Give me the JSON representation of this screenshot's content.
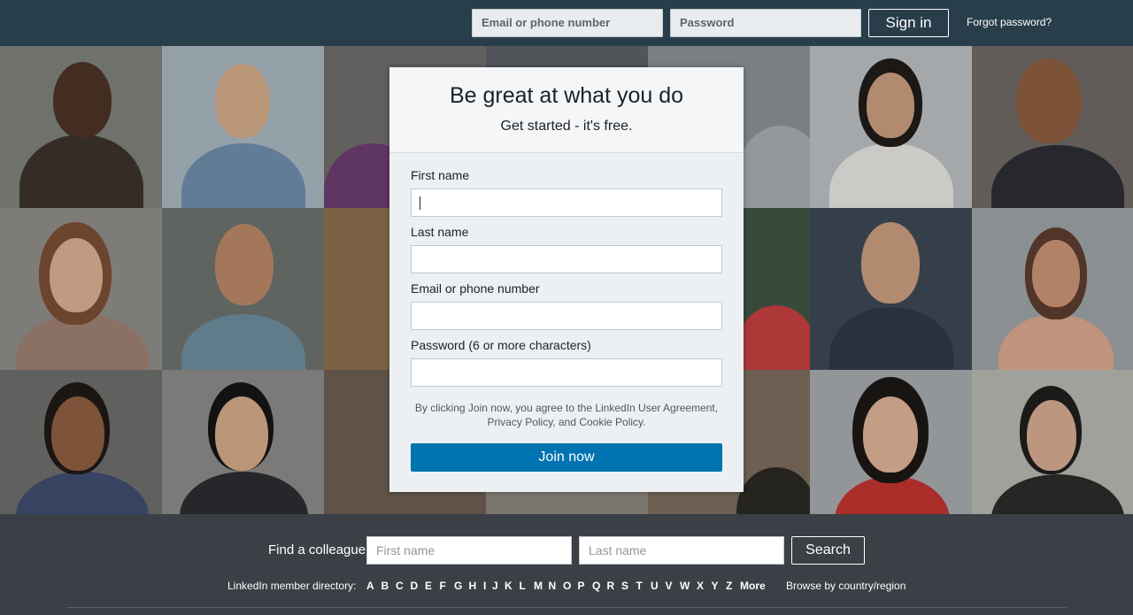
{
  "topbar": {
    "email_placeholder": "Email or phone number",
    "password_placeholder": "Password",
    "signin_label": "Sign in",
    "forgot_label": "Forgot password?"
  },
  "signup": {
    "title": "Be great at what you do",
    "subtitle": "Get started - it's free.",
    "fields": {
      "first_name": "First name",
      "last_name": "Last name",
      "email": "Email or phone number",
      "password": "Password (6 or more characters)"
    },
    "legal_line1": "By clicking Join now, you agree to the LinkedIn User Agreement,",
    "legal_line2": "Privacy Policy, and Cookie Policy.",
    "join_label": "Join now"
  },
  "find": {
    "label": "Find a colleague",
    "first_placeholder": "First name",
    "last_placeholder": "Last name",
    "search_label": "Search"
  },
  "directory": {
    "label": "LinkedIn member directory:",
    "letters": [
      "A",
      "B",
      "C",
      "D",
      "E",
      "F",
      "G",
      "H",
      "I",
      "J",
      "K",
      "L",
      "M",
      "N",
      "O",
      "P",
      "Q",
      "R",
      "S",
      "T",
      "U",
      "V",
      "W",
      "X",
      "Y",
      "Z"
    ],
    "more_label": "More",
    "country_label": "Browse by country/region"
  },
  "colors": {
    "topbar": "#283e4a",
    "primary_button": "#0073b1",
    "footer": "#3a4046"
  }
}
